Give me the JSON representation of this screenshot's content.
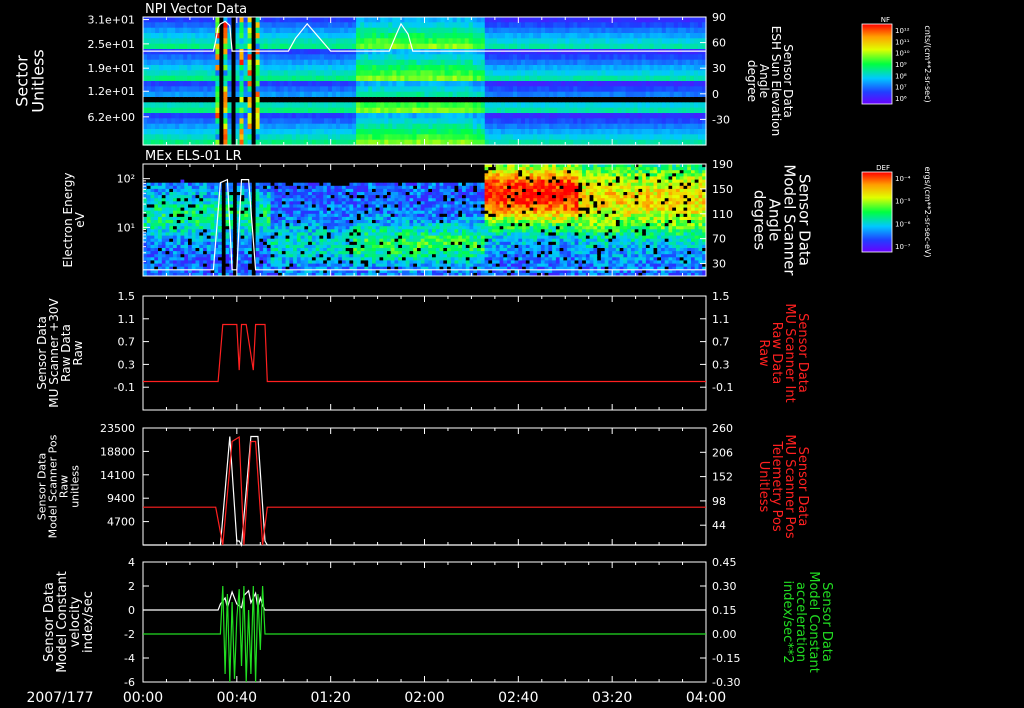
{
  "colors": {
    "background": "#000000",
    "axis": "#ffffff",
    "red_trace": "#ff2020",
    "green_trace": "#22dd22",
    "white_trace": "#ffffff"
  },
  "time_axis": {
    "date_label": "2007/177",
    "ticks": [
      "00:00",
      "00:40",
      "01:20",
      "02:00",
      "02:40",
      "03:20",
      "04:00"
    ],
    "range_minutes": [
      0,
      240
    ]
  },
  "chart_data": [
    {
      "type": "heatmap",
      "title": "NPI Vector Data",
      "ylabel": [
        "Sector",
        "Unitless"
      ],
      "yticks": [
        "3.1e+01",
        "2.5e+01",
        "1.9e+01",
        "1.2e+01",
        "6.2e+00"
      ],
      "ylabel_right": [
        "Sensor Data",
        "ESH Sun Elevation",
        "Angle",
        "degree"
      ],
      "yticks_right": [
        "90",
        "60",
        "30",
        "0",
        "-30"
      ],
      "ylim_right": [
        -60,
        90
      ],
      "colorbar": {
        "label": "NF",
        "unit": "cnts/(cm**2-sr-sec)",
        "ticks": [
          "10¹²",
          "10¹¹",
          "10¹⁰",
          "10⁹",
          "10⁸",
          "10⁷",
          "10⁶"
        ]
      },
      "overlay_series": {
        "name": "",
        "x_minutes": [
          0,
          30,
          31,
          32,
          33,
          35,
          37,
          38,
          40,
          45,
          50,
          55,
          60,
          62,
          65,
          70,
          80,
          95,
          100,
          105,
          108,
          110,
          113,
          115,
          120,
          240
        ],
        "y": [
          50,
          50,
          62,
          78,
          82,
          85,
          80,
          50,
          50,
          50,
          50,
          50,
          50,
          50,
          65,
          82,
          50,
          50,
          50,
          50,
          70,
          82,
          70,
          50,
          50,
          50
        ]
      }
    },
    {
      "type": "heatmap",
      "title": "MEx ELS-01 LR",
      "ylabel": [
        "Electron Energy",
        "eV"
      ],
      "yticks": [
        "10²",
        "10¹"
      ],
      "ylim": [
        1,
        200
      ],
      "yscale": "log",
      "ylabel_right": [
        "Sensor Data",
        "Model Scanner",
        "Angle",
        "degrees"
      ],
      "yticks_right": [
        "190",
        "150",
        "110",
        "70",
        "30"
      ],
      "ylim_right": [
        10,
        190
      ],
      "colorbar": {
        "label": "DEF",
        "unit": "ergs/(cm**2-sr-sec-eV)",
        "ticks": [
          "10⁻⁴",
          "10⁻⁵",
          "10⁻⁶",
          "10⁻⁷"
        ]
      },
      "overlay_series": {
        "name": "",
        "x_minutes": [
          0,
          30,
          33,
          36,
          38,
          40,
          42,
          45,
          48,
          51,
          240
        ],
        "y": [
          20,
          20,
          160,
          165,
          20,
          20,
          165,
          165,
          20,
          20,
          20
        ]
      }
    },
    {
      "type": "line",
      "title": "",
      "ylabel": [
        "Sensor Data",
        "MU Scanner +30V",
        "Raw Data",
        "Raw"
      ],
      "ylim": [
        -0.5,
        1.5
      ],
      "yticks": [
        "1.5",
        "1.1",
        "0.7",
        "0.3",
        "-0.1"
      ],
      "yticks_values": [
        1.5,
        1.1,
        0.7,
        0.3,
        -0.1
      ],
      "ylabel_right": [
        "Sensor Data",
        "MU Scanner Int",
        "Raw Data",
        "Raw"
      ],
      "ylim_right": [
        -0.5,
        1.5
      ],
      "yticks_right": [
        "1.5",
        "1.1",
        "0.7",
        "0.3",
        "-0.1"
      ],
      "series": [
        {
          "name": "",
          "axis": "left",
          "color": "#ff2020",
          "x_minutes": [
            0,
            32,
            34,
            40,
            41,
            42,
            43,
            44,
            47,
            48,
            49,
            50,
            52,
            53,
            240
          ],
          "y": [
            0,
            0,
            1,
            1,
            0.2,
            1,
            1,
            1,
            0.2,
            1,
            1,
            1,
            1,
            0,
            0
          ]
        }
      ]
    },
    {
      "type": "line",
      "title": "",
      "ylabel": [
        "Sensor Data",
        "Model Scanner Pos",
        "Raw",
        "unitless"
      ],
      "ylim": [
        0,
        23500
      ],
      "yticks": [
        "23500",
        "18800",
        "14100",
        "9400",
        "4700"
      ],
      "yticks_values": [
        23500,
        18800,
        14100,
        9400,
        4700
      ],
      "ylabel_right": [
        "Sensor Data",
        "MU Scanner Pos",
        "Telemetry Pos",
        "Unitless"
      ],
      "ylim_right": [
        0,
        260
      ],
      "yticks_right": [
        "260",
        "206",
        "152",
        "98",
        "44"
      ],
      "yticks_right_values": [
        260,
        206,
        152,
        98,
        44
      ],
      "series": [
        {
          "name": "",
          "axis": "left",
          "color": "#ffffff",
          "x_minutes": [
            0,
            30,
            33,
            37,
            40,
            41,
            42,
            46,
            49,
            52,
            53,
            240
          ],
          "y": [
            0,
            0,
            0,
            21800,
            800,
            800,
            0,
            21800,
            21800,
            800,
            0,
            0
          ]
        },
        {
          "name": "",
          "axis": "right",
          "color": "#ff2020",
          "x_minutes": [
            0,
            31,
            34,
            38,
            41,
            43,
            46,
            48,
            51,
            53,
            55,
            240
          ],
          "y": [
            84,
            84,
            0,
            230,
            240,
            0,
            230,
            230,
            0,
            84,
            84,
            84
          ]
        }
      ]
    },
    {
      "type": "line",
      "title": "",
      "ylabel": [
        "Sensor Data",
        "Model Constant",
        "velocity",
        "index/sec"
      ],
      "ylim": [
        -6,
        4
      ],
      "yticks": [
        "4",
        "2",
        "0",
        "-2",
        "-4",
        "-6"
      ],
      "yticks_values": [
        4,
        2,
        0,
        -2,
        -4,
        -6
      ],
      "ylabel_right": [
        "Sensor Data",
        "Model Constant",
        "acceleration",
        "index/sec**2"
      ],
      "ylim_right": [
        -0.3,
        0.45
      ],
      "yticks_right": [
        "0.45",
        "0.30",
        "0.15",
        "0.00",
        "-0.15",
        "-0.30"
      ],
      "yticks_right_values": [
        0.45,
        0.3,
        0.15,
        0.0,
        -0.15,
        -0.3
      ],
      "series": [
        {
          "name": "",
          "axis": "left",
          "color": "#ffffff",
          "x_minutes": [
            0,
            30,
            32,
            33,
            35,
            36,
            38,
            40,
            42,
            43,
            45,
            46,
            48,
            49,
            50,
            51,
            52,
            53,
            240
          ],
          "y": [
            0,
            0,
            0,
            0.5,
            1,
            0.2,
            1.5,
            0.5,
            0.2,
            1.2,
            1.6,
            0.6,
            1.4,
            0.2,
            1,
            0.4,
            0,
            0,
            0
          ]
        },
        {
          "name": "",
          "axis": "right",
          "color": "#22dd22",
          "x_minutes": [
            0,
            33,
            34,
            35,
            36,
            37,
            38,
            39,
            40,
            41,
            42,
            43,
            44,
            45,
            46,
            47,
            48,
            49,
            50,
            51,
            52,
            240
          ],
          "y": [
            0,
            0,
            0.3,
            -0.25,
            0.25,
            -0.3,
            0.2,
            -0.28,
            0.1,
            0.28,
            -0.2,
            0.3,
            -0.3,
            0.15,
            -0.25,
            0.3,
            -0.3,
            0.25,
            -0.1,
            0.3,
            0,
            0
          ]
        }
      ]
    }
  ]
}
